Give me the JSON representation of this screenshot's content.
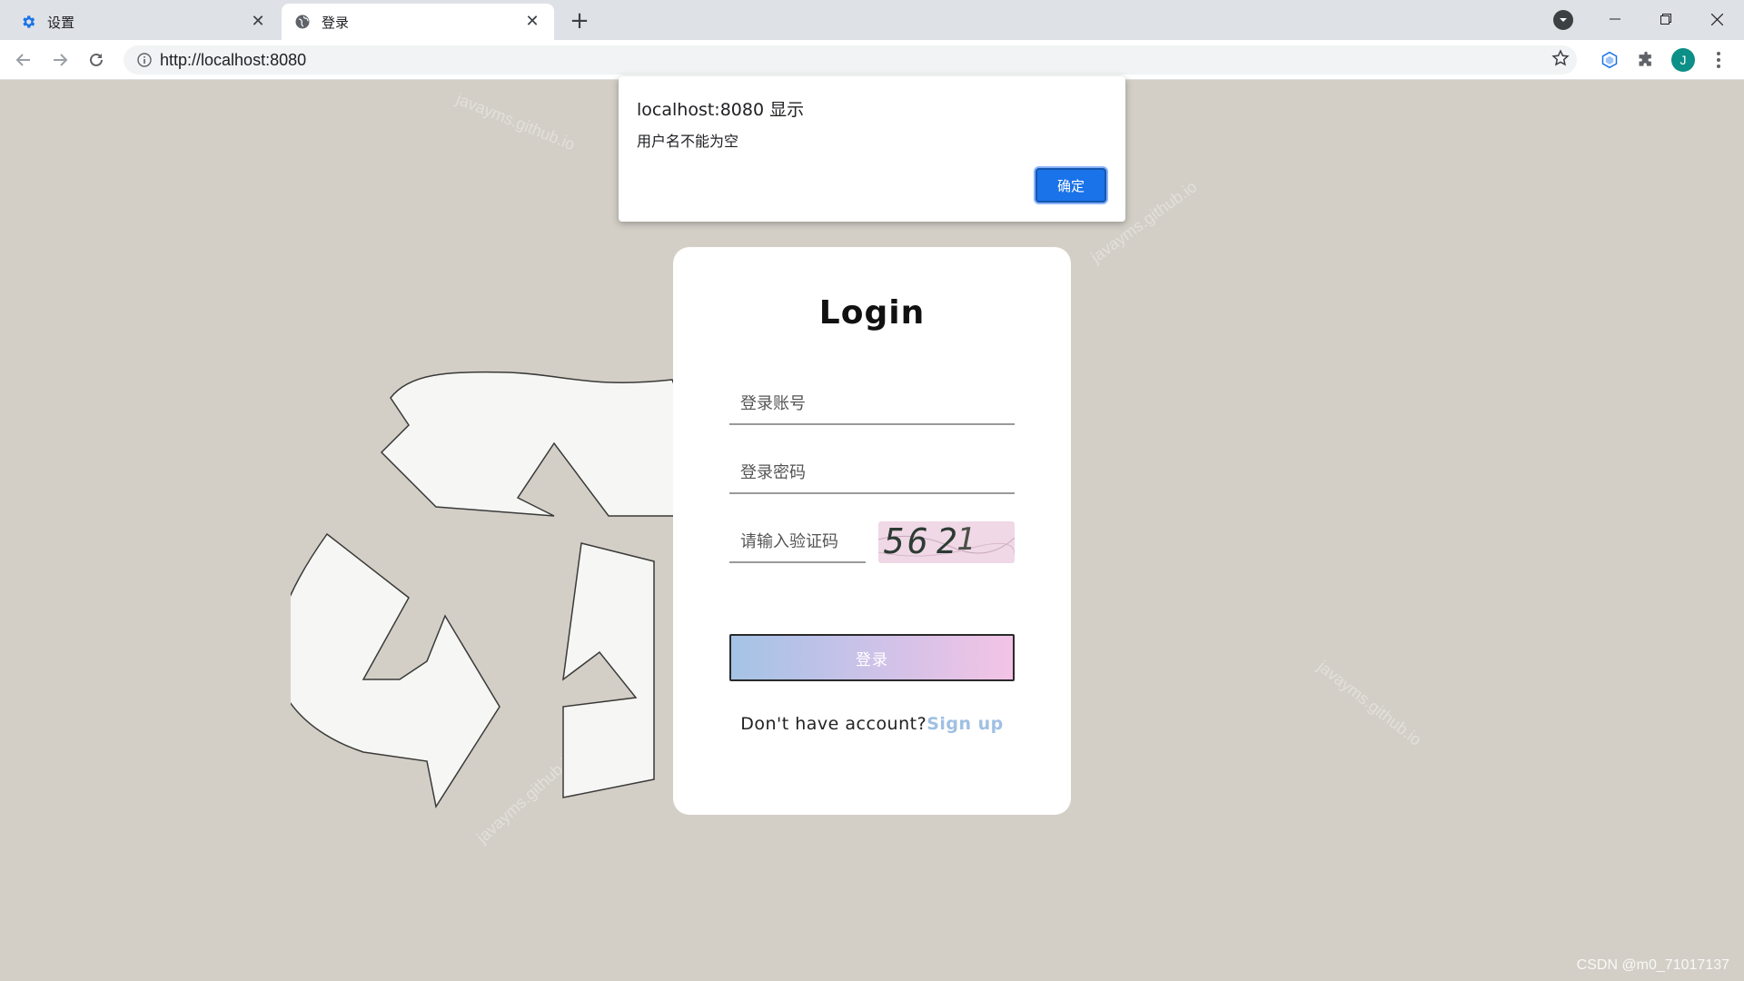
{
  "tabs": [
    {
      "title": "设置",
      "icon": "gear-icon",
      "active": false
    },
    {
      "title": "登录",
      "icon": "globe-icon",
      "active": true
    }
  ],
  "address_bar": {
    "url": "http://localhost:8080"
  },
  "login": {
    "title": "Login",
    "account_placeholder": "登录账号",
    "password_placeholder": "登录密码",
    "captcha_placeholder": "请输入验证码",
    "captcha_chars": [
      "5",
      "6",
      "2",
      "1"
    ],
    "login_button": "登录",
    "signup_prompt": "Don't have account?",
    "signup_link": "Sign up"
  },
  "alert": {
    "title": "localhost:8080 显示",
    "message": "用户名不能为空",
    "ok_label": "确定"
  },
  "watermark_text": "javayms.github.io",
  "csdn_credit": "CSDN @m0_71017137",
  "colors": {
    "page_bg": "#d3cfc7",
    "accent_blue": "#1a73e8",
    "signup_link": "#9fc0e2",
    "button_gradient_start": "#a4c3e6",
    "button_gradient_end": "#f3c3e6",
    "avatar_bg": "#0b8f87"
  },
  "avatar_letter": "J"
}
